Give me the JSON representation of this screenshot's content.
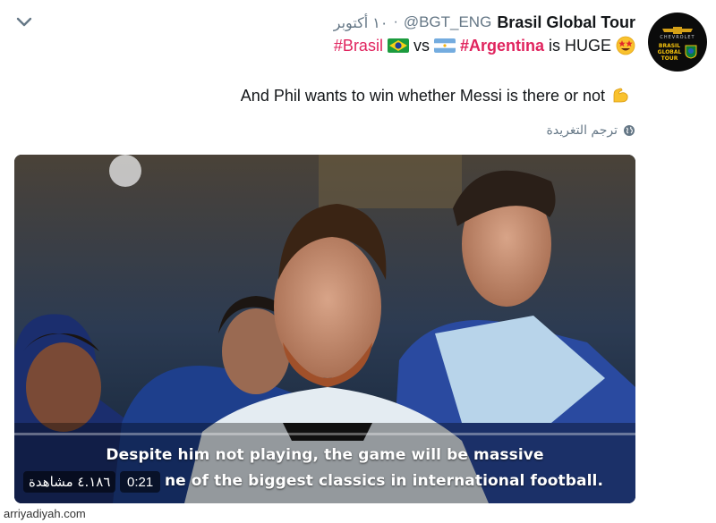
{
  "tweet": {
    "display_name": "Brasil Global Tour",
    "handle": "@BGT_ENG",
    "date": "١٠ أكتوبر",
    "line1": {
      "hashtag_1": "#Brasil",
      "vs": "vs",
      "hashtag_2": "#Argentina",
      "rest": "is HUGE"
    },
    "line2": "And Phil wants to win whether Messi is there or not",
    "translate_label": "ترجم التغريدة"
  },
  "avatar": {
    "sponsor": "CHEVROLET",
    "logo_text_line1": "BRASIL",
    "logo_text_line2": "GLOBAL",
    "logo_text_line3": "TOUR"
  },
  "video": {
    "subtitle_line1": "Despite him not playing, the game will be massive",
    "subtitle_line2": "ne of the biggest classics in international football.",
    "time": "0:21",
    "views": "٤.١٨٦ مشاهدة",
    "progress": 0.0
  },
  "watermark": "arriyadiyah.com",
  "icons": {
    "menu": "chevron-down-icon",
    "brazil_flag": "brazil-flag-icon",
    "argentina_flag": "argentina-flag-icon",
    "emoji_1": "star-struck-emoji-icon",
    "emoji_2": "flexed-biceps-emoji-icon",
    "globe": "globe-icon"
  },
  "colors": {
    "hashtag": "#e0245e",
    "secondary_text": "#657786",
    "accent": "#1da1f2"
  }
}
